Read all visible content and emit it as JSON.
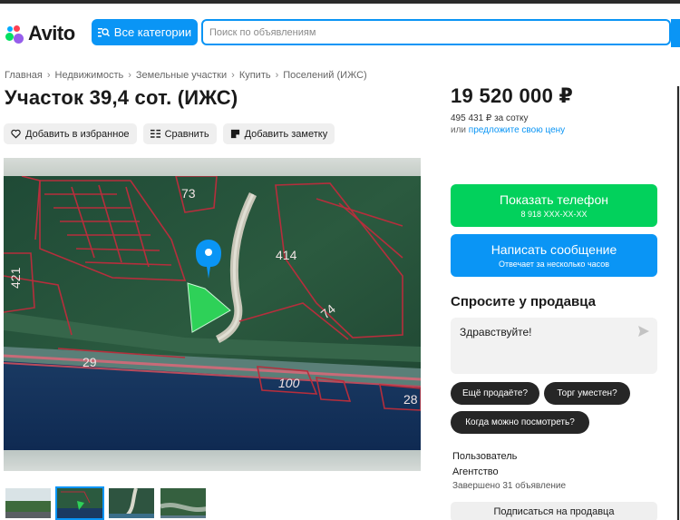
{
  "header": {
    "logo_text": "Avito",
    "categories_label": "Все категории",
    "search_placeholder": "Поиск по объявлениям"
  },
  "breadcrumb": [
    "Главная",
    "Недвижимость",
    "Земельные участки",
    "Купить",
    "Поселений (ИЖС)"
  ],
  "listing": {
    "title": "Участок 39,4 сот. (ИЖС)",
    "actions": {
      "favorite": "Добавить в избранное",
      "compare": "Сравнить",
      "note": "Добавить заметку"
    },
    "map_labels": {
      "plot_73": "73",
      "plot_414": "414",
      "plot_421": "421",
      "plot_74": "74",
      "plot_29": "29",
      "plot_100": "100",
      "plot_28": "28"
    }
  },
  "pricing": {
    "price": "19 520 000 ₽",
    "per_unit": "495 431 ₽ за сотку",
    "offer_prefix": "или ",
    "offer_link": "предложите свою цену"
  },
  "contact": {
    "phone_label": "Показать телефон",
    "phone_masked": "8 918 XXX-XX-XX",
    "message_label": "Написать сообщение",
    "message_sub": "Отвечает за несколько часов"
  },
  "ask": {
    "title": "Спросите у продавца",
    "message_value": "Здравствуйте!",
    "chips": [
      "Ещё продаёте?",
      "Торг уместен?",
      "Когда можно посмотреть?"
    ]
  },
  "seller": {
    "name": "Пользователь",
    "type": "Агентство",
    "completed": "Завершено 31 объявление",
    "subscribe_label": "Подписаться на продавца"
  },
  "colors": {
    "accent_blue": "#0a95f5",
    "phone_green": "#02d15c",
    "chip_dark": "#262626"
  }
}
